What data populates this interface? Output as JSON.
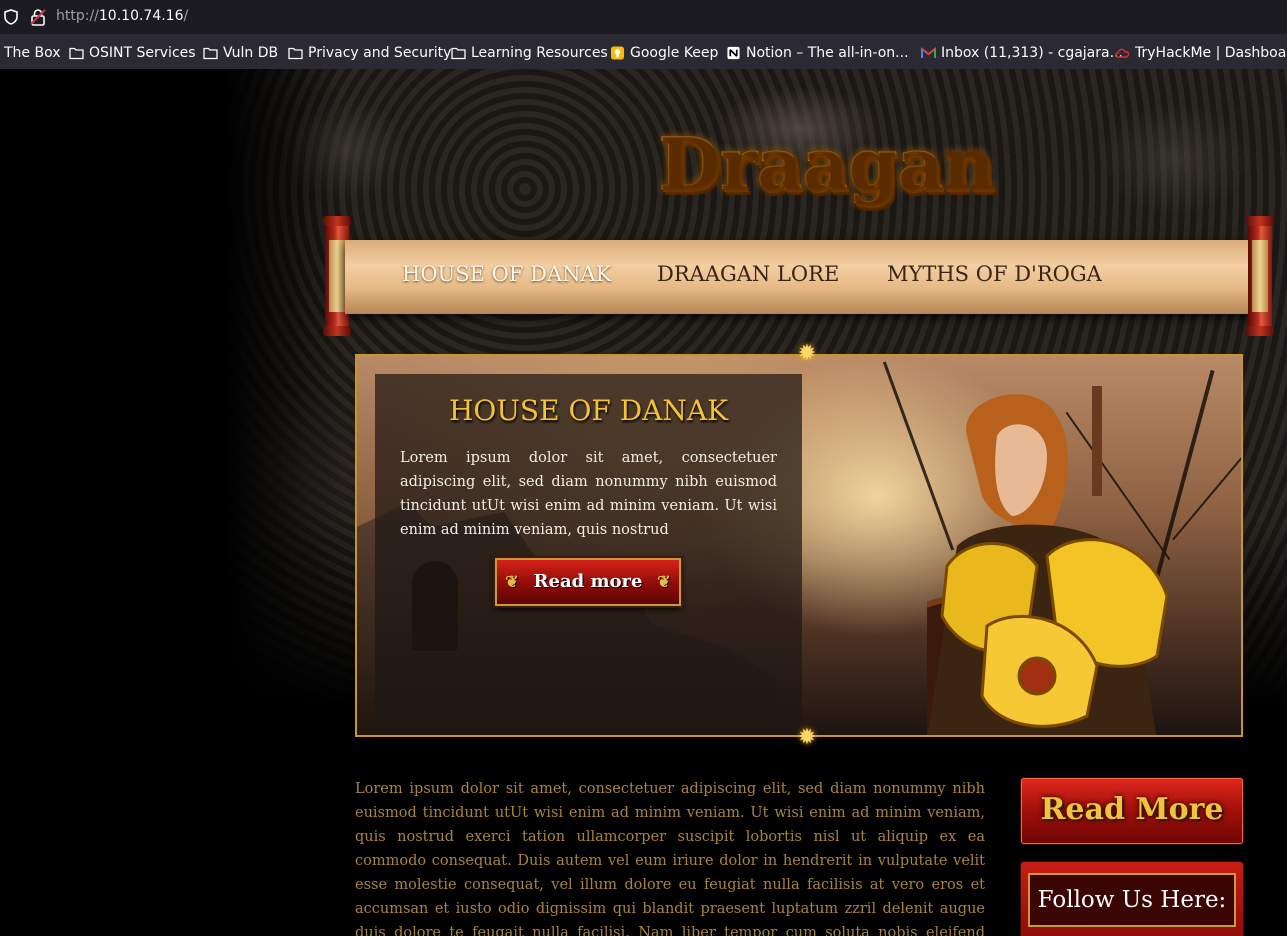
{
  "browser": {
    "url_scheme": "http://",
    "url_host": "10.10.74.16",
    "url_path": "/",
    "bookmarks": [
      {
        "label": "The Box",
        "icon": "none"
      },
      {
        "label": "OSINT Services",
        "icon": "folder-icon"
      },
      {
        "label": "Vuln DB",
        "icon": "folder-icon"
      },
      {
        "label": "Privacy and Security",
        "icon": "folder-icon"
      },
      {
        "label": "Learning Resources",
        "icon": "folder-icon"
      },
      {
        "label": "Google Keep",
        "icon": "google-keep-icon"
      },
      {
        "label": "Notion – The all-in-on...",
        "icon": "notion-icon"
      },
      {
        "label": "Inbox (11,313) - cgajara...",
        "icon": "gmail-icon"
      },
      {
        "label": "TryHackMe | Dashboard",
        "icon": "tryhackme-icon"
      }
    ]
  },
  "site": {
    "logo_text": "Draagan",
    "nav": [
      {
        "label": "HOUSE OF DANAK",
        "active": true
      },
      {
        "label": "DRAAGAN LORE",
        "active": false
      },
      {
        "label": "MYTHS OF D'ROGA",
        "active": false
      }
    ],
    "hero": {
      "title": "HOUSE OF DANAK",
      "text": "Lorem ipsum dolor sit amet, consectetuer adipiscing elit, sed diam nonummy nibh euismod tincidunt utUt wisi enim ad minim veniam. Ut wisi enim ad minim veniam, quis nostrud",
      "button_label": "Read more"
    },
    "body_text": "Lorem ipsum dolor sit amet, consectetuer adipiscing elit, sed diam nonummy nibh euismod tincidunt utUt wisi enim ad minim veniam. Ut wisi enim ad minim veniam, quis nostrud exerci tation ullamcorper suscipit lobortis nisl ut aliquip ex ea commodo consequat. Duis autem vel eum iriure dolor in hendrerit in vulputate velit esse molestie consequat, vel illum dolore eu feugiat nulla facilisis at vero eros et accumsan et iusto odio dignissim qui blandit praesent luptatum zzril delenit augue duis dolore te feugait nulla facilisi. Nam liber tempor cum soluta nobis eleifend option congue nihil imperdiet",
    "side_button_label": "Read More",
    "follow_label": "Follow Us Here:"
  },
  "colors": {
    "accent_gold": "#f5c232",
    "nav_active": "#fffaf0",
    "button_red": "#a00f0a",
    "body_text": "#a8843c"
  }
}
